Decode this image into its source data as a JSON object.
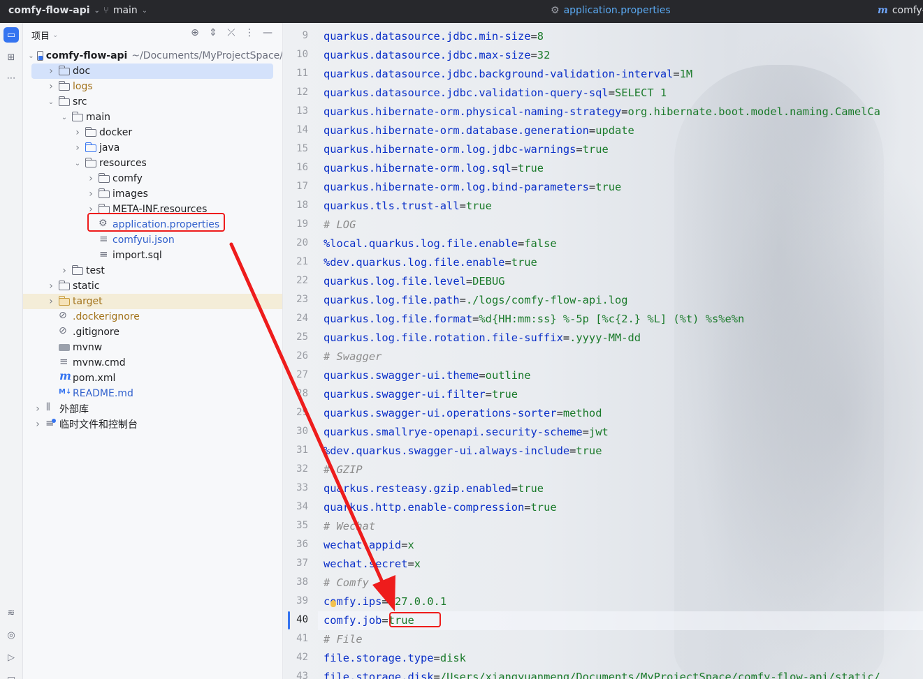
{
  "titlebar": {
    "project": "comfy-flow-api",
    "branch": "main",
    "open_file": "application.properties",
    "right_project": "comfy-"
  },
  "panel": {
    "title": "项目",
    "icons": [
      "locate-icon",
      "expand-icon",
      "collapse-icon",
      "more-icon",
      "minimize-icon"
    ]
  },
  "tree": [
    {
      "label": "comfy-flow-api",
      "path": "~/Documents/MyProjectSpace/",
      "level": 0,
      "arrow": "down",
      "icon": "project-folder-icon",
      "style": "bold"
    },
    {
      "label": "doc",
      "level": 1,
      "arrow": "right",
      "icon": "folder-icon",
      "selected": true
    },
    {
      "label": "logs",
      "level": 1,
      "arrow": "right",
      "icon": "folder-icon",
      "style": "orange"
    },
    {
      "label": "src",
      "level": 1,
      "arrow": "down",
      "icon": "folder-icon"
    },
    {
      "label": "main",
      "level": 2,
      "arrow": "down",
      "icon": "folder-icon"
    },
    {
      "label": "docker",
      "level": 3,
      "arrow": "right",
      "icon": "folder-icon"
    },
    {
      "label": "java",
      "level": 3,
      "arrow": "right",
      "icon": "folder-blue-icon"
    },
    {
      "label": "resources",
      "level": 3,
      "arrow": "down",
      "icon": "resources-folder-icon"
    },
    {
      "label": "comfy",
      "level": 4,
      "arrow": "right",
      "icon": "folder-icon"
    },
    {
      "label": "images",
      "level": 4,
      "arrow": "right",
      "icon": "folder-icon"
    },
    {
      "label": "META-INF.resources",
      "level": 4,
      "arrow": "right",
      "icon": "folder-icon"
    },
    {
      "label": "application.properties",
      "level": 4,
      "arrow": "",
      "icon": "settings-file-icon",
      "style": "blue"
    },
    {
      "label": "comfyui.json",
      "level": 4,
      "arrow": "",
      "icon": "text-file-icon",
      "style": "blue"
    },
    {
      "label": "import.sql",
      "level": 4,
      "arrow": "",
      "icon": "text-file-icon"
    },
    {
      "label": "test",
      "level": 2,
      "arrow": "right",
      "icon": "folder-icon"
    },
    {
      "label": "static",
      "level": 1,
      "arrow": "right",
      "icon": "folder-icon"
    },
    {
      "label": "target",
      "level": 1,
      "arrow": "right",
      "icon": "folder-excluded-icon",
      "style": "orange",
      "excluded": true
    },
    {
      "label": ".dockerignore",
      "level": 1,
      "arrow": "",
      "icon": "ignore-file-icon",
      "style": "orange"
    },
    {
      "label": ".gitignore",
      "level": 1,
      "arrow": "",
      "icon": "ignore-file-icon"
    },
    {
      "label": "mvnw",
      "level": 1,
      "arrow": "",
      "icon": "shell-file-icon"
    },
    {
      "label": "mvnw.cmd",
      "level": 1,
      "arrow": "",
      "icon": "text-file-icon"
    },
    {
      "label": "pom.xml",
      "level": 1,
      "arrow": "",
      "icon": "maven-file-icon"
    },
    {
      "label": "README.md",
      "level": 1,
      "arrow": "",
      "icon": "markdown-file-icon",
      "style": "blue"
    },
    {
      "label": "外部库",
      "level": 0,
      "arrow": "right",
      "icon": "library-icon"
    },
    {
      "label": "临时文件和控制台",
      "level": 0,
      "arrow": "right",
      "icon": "scratch-icon"
    }
  ],
  "editor": {
    "current_line": "40",
    "lines": [
      {
        "n": "9",
        "k": "quarkus.datasource.jdbc.min-size",
        "v": "8"
      },
      {
        "n": "10",
        "k": "quarkus.datasource.jdbc.max-size",
        "v": "32"
      },
      {
        "n": "11",
        "k": "quarkus.datasource.jdbc.background-validation-interval",
        "v": "1M"
      },
      {
        "n": "12",
        "k": "quarkus.datasource.jdbc.validation-query-sql",
        "v": "SELECT 1"
      },
      {
        "n": "13",
        "k": "quarkus.hibernate-orm.physical-naming-strategy",
        "v": "org.hibernate.boot.model.naming.CamelCa"
      },
      {
        "n": "14",
        "k": "quarkus.hibernate-orm.database.generation",
        "v": "update"
      },
      {
        "n": "15",
        "k": "quarkus.hibernate-orm.log.jdbc-warnings",
        "v": "true"
      },
      {
        "n": "16",
        "k": "quarkus.hibernate-orm.log.sql",
        "v": "true"
      },
      {
        "n": "17",
        "k": "quarkus.hibernate-orm.log.bind-parameters",
        "v": "true"
      },
      {
        "n": "18",
        "k": "quarkus.tls.trust-all",
        "v": "true"
      },
      {
        "n": "19",
        "c": "# LOG"
      },
      {
        "n": "20",
        "k": "%local.quarkus.log.file.enable",
        "v": "false"
      },
      {
        "n": "21",
        "k": "%dev.quarkus.log.file.enable",
        "v": "true"
      },
      {
        "n": "22",
        "k": "quarkus.log.file.level",
        "v": "DEBUG"
      },
      {
        "n": "23",
        "k": "quarkus.log.file.path",
        "v": "./logs/comfy-flow-api.log"
      },
      {
        "n": "24",
        "k": "quarkus.log.file.format",
        "v": "%d{HH:mm:ss} %-5p [%c{2.} %L] (%t) %s%e%n"
      },
      {
        "n": "25",
        "k": "quarkus.log.file.rotation.file-suffix",
        "v": ".yyyy-MM-dd"
      },
      {
        "n": "26",
        "c": "# Swagger"
      },
      {
        "n": "27",
        "k": "quarkus.swagger-ui.theme",
        "v": "outline"
      },
      {
        "n": "28",
        "k": "quarkus.swagger-ui.filter",
        "v": "true"
      },
      {
        "n": "29",
        "k": "quarkus.swagger-ui.operations-sorter",
        "v": "method"
      },
      {
        "n": "30",
        "k": "quarkus.smallrye-openapi.security-scheme",
        "v": "jwt"
      },
      {
        "n": "31",
        "k": "%dev.quarkus.swagger-ui.always-include",
        "v": "true"
      },
      {
        "n": "32",
        "c": "# GZIP"
      },
      {
        "n": "33",
        "k": "quarkus.resteasy.gzip.enabled",
        "v": "true"
      },
      {
        "n": "34",
        "k": "quarkus.http.enable-compression",
        "v": "true"
      },
      {
        "n": "35",
        "c": "# Wechat"
      },
      {
        "n": "36",
        "k": "wechat.appid",
        "v": "x"
      },
      {
        "n": "37",
        "k": "wechat.secret",
        "v": "x"
      },
      {
        "n": "38",
        "c": "# Comfy"
      },
      {
        "n": "39",
        "k": "comfy.ips",
        "v": "127.0.0.1"
      },
      {
        "n": "40",
        "k": "comfy.job",
        "v": "true"
      },
      {
        "n": "41",
        "c": "# File"
      },
      {
        "n": "42",
        "k": "file.storage.type",
        "v": "disk"
      },
      {
        "n": "43",
        "k": "file.storage.disk",
        "v": "/Users/xiangyuanmeng/Documents/MyProjectSpace/comfy-flow-api/static/"
      }
    ]
  },
  "colors": {
    "key": "#0a2fc8",
    "value": "#1a7a2a",
    "comment": "#8c8c8c",
    "annotation": "#ee1c1c",
    "accent": "#3574f0"
  }
}
